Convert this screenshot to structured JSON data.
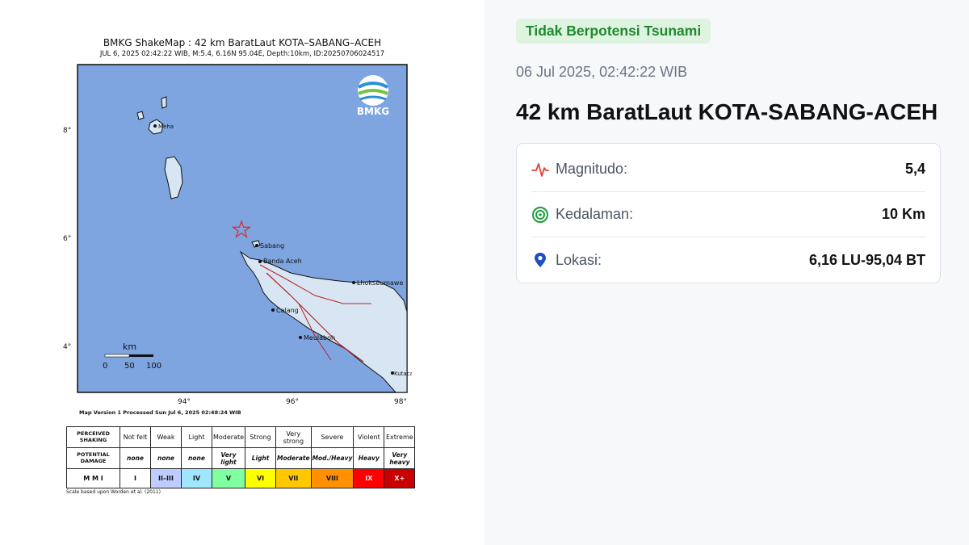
{
  "shakemap": {
    "title": "BMKG ShakeMap : 42 km BaratLaut KOTA–SABANG–ACEH",
    "subtitle": "JUL 6, 2025 02:42:22 WIB, M:5.4, 6.16N 95.04E, Depth:10km, ID:20250706024517",
    "logo_text": "BMKG",
    "lat_ticks": [
      "8°",
      "6°",
      "4°"
    ],
    "lon_ticks": [
      "94°",
      "96°",
      "98°"
    ],
    "scale_label": "km",
    "scale_ticks": [
      "0",
      "50",
      "100"
    ],
    "places": [
      "Sabang",
      "Banda Aceh",
      "Lhokseumawe",
      "Calang",
      "Meulaboh",
      "Kutacane",
      "Meha"
    ],
    "map_version": "Map Version 1 Processed Sun Jul  6, 2025 02:48:24 WIB",
    "scale_note": "Scale based upon Worden et al. (2011)",
    "table": {
      "row_headers": [
        "PERCEIVED SHAKING",
        "POTENTIAL DAMAGE",
        "M M I"
      ],
      "shaking": [
        "Not felt",
        "Weak",
        "Light",
        "Moderate",
        "Strong",
        "Very strong",
        "Severe",
        "Violent",
        "Extreme"
      ],
      "damage": [
        "none",
        "none",
        "none",
        "Very light",
        "Light",
        "Moderate",
        "Mod./Heavy",
        "Heavy",
        "Very heavy"
      ],
      "mmi": [
        "I",
        "II–III",
        "IV",
        "V",
        "VI",
        "VII",
        "VIII",
        "IX",
        "X+"
      ],
      "mmi_colors": [
        "#ffffff",
        "#bfccff",
        "#a0e6ff",
        "#80ffa0",
        "#ffff00",
        "#ffc800",
        "#ff9100",
        "#ff0000",
        "#c80000"
      ]
    }
  },
  "info": {
    "tsunami_badge": "Tidak Berpotensi Tsunami",
    "datetime": "06 Jul 2025, 02:42:22 WIB",
    "location": "42 km BaratLaut KOTA-SABANG-ACEH",
    "details": [
      {
        "icon": "pulse-icon",
        "label": "Magnitudo:",
        "value": "5,4"
      },
      {
        "icon": "target-icon",
        "label": "Kedalaman:",
        "value": "10 Km"
      },
      {
        "icon": "location-pin-icon",
        "label": "Lokasi:",
        "value": "6,16 LU-95,04 BT"
      }
    ],
    "colors": {
      "badge_bg": "#dff3e1",
      "badge_text": "#1e8a2e",
      "pulse": "#e0413b",
      "target": "#1a9e3a",
      "pin": "#1d4fc4",
      "sea": "#7ea5df"
    }
  }
}
